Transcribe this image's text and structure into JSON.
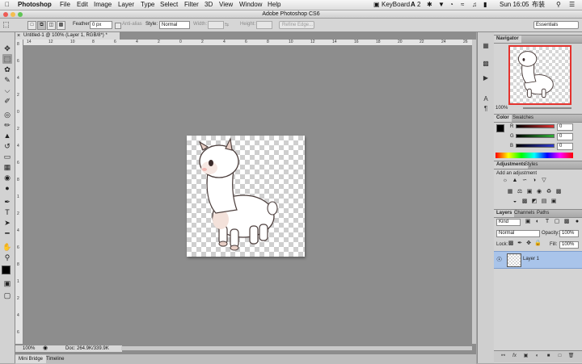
{
  "menubar": {
    "app": "Photoshop",
    "items": [
      "File",
      "Edit",
      "Image",
      "Layer",
      "Type",
      "Select",
      "Filter",
      "3D",
      "View",
      "Window",
      "Help"
    ],
    "status": {
      "keyboard": "KeyBoard",
      "input": "A",
      "day_time": "Sun 16:05",
      "user": "布装"
    }
  },
  "window": {
    "title": "Adobe Photoshop CS6"
  },
  "options": {
    "feather_label": "Feather:",
    "feather_value": "0 px",
    "antialias_label": "Anti-alias",
    "style_label": "Style:",
    "style_value": "Normal",
    "width_label": "Width:",
    "height_label": "Height:",
    "refine_label": "Refine Edge...",
    "workspace": "Essentials"
  },
  "document": {
    "tab_title": "Untitled-1 @ 100% (Layer 1, RGB/8*) *",
    "zoom": "100%",
    "doc_info": "Doc: 264.9K/339.9K",
    "ruler_top": [
      "14",
      "12",
      "10",
      "8",
      "6",
      "4",
      "2",
      "0",
      "2",
      "4",
      "6",
      "8",
      "10",
      "12",
      "14",
      "16",
      "18",
      "20",
      "22",
      "24",
      "26"
    ],
    "ruler_left": [
      "8",
      "6",
      "4",
      "2",
      "0",
      "2",
      "4",
      "6",
      "8",
      "1",
      "2",
      "4",
      "6",
      "8",
      "1",
      "2",
      "4",
      "6"
    ]
  },
  "bottom_tabs": [
    "Mini Bridge",
    "Timeline"
  ],
  "navigator": {
    "title": "Navigator",
    "zoom": "100%"
  },
  "color": {
    "tabs": [
      "Color",
      "Swatches"
    ],
    "channels": [
      {
        "label": "R",
        "value": "0"
      },
      {
        "label": "G",
        "value": "0"
      },
      {
        "label": "B",
        "value": "0"
      }
    ],
    "channel_colors": [
      "#d23030",
      "#2fa036",
      "#2e3ad0"
    ]
  },
  "adjustments": {
    "tabs": [
      "Adjustments",
      "Styles"
    ],
    "add_label": "Add an adjustment"
  },
  "layers": {
    "tabs": [
      "Layers",
      "Channels",
      "Paths"
    ],
    "filter_kind": "Kind",
    "blend_mode": "Normal",
    "opacity_label": "Opacity:",
    "opacity_value": "100%",
    "lock_label": "Lock:",
    "fill_label": "Fill:",
    "fill_value": "100%",
    "layer_name": "Layer 1"
  },
  "bottom_icons": [
    "link-icon",
    "fx-icon",
    "mask-icon",
    "adjustment-icon",
    "group-icon",
    "new-layer-icon",
    "trash-icon"
  ]
}
